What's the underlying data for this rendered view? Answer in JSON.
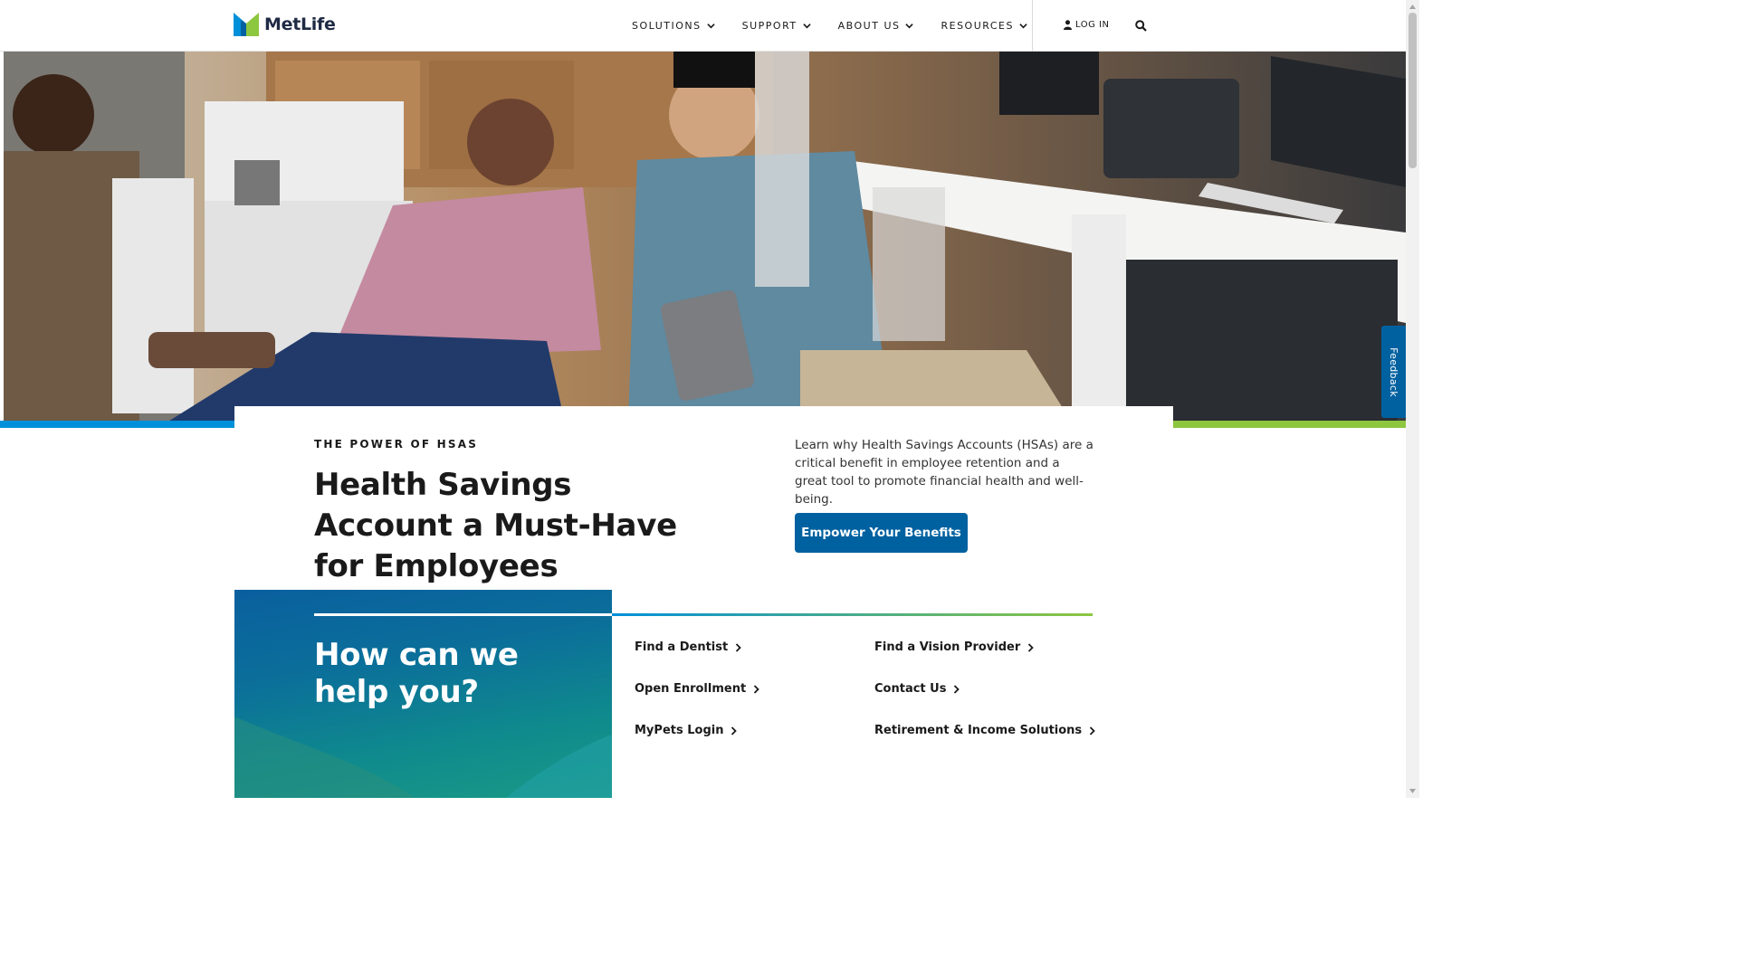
{
  "header": {
    "logo_text": "MetLife",
    "nav": [
      {
        "label": "SOLUTIONS"
      },
      {
        "label": "SUPPORT"
      },
      {
        "label": "ABOUT US"
      },
      {
        "label": "RESOURCES"
      }
    ],
    "login_label": "LOG IN"
  },
  "hero": {
    "feedback_label": "Feedback"
  },
  "feature": {
    "eyebrow": "THE POWER OF HSAS",
    "headline": "Health Savings Account a Must-Have for Employees",
    "intro": "Learn why Health Savings Accounts (HSAs) are a critical benefit in employee retention and a great tool to promote financial health and well-being.",
    "cta_label": "Empower Your Benefits"
  },
  "help": {
    "title": "How can we help you?",
    "links": [
      {
        "label": "Find a Dentist"
      },
      {
        "label": "Find a Vision Provider"
      },
      {
        "label": "Open Enrollment"
      },
      {
        "label": "Contact Us"
      },
      {
        "label": "MyPets Login"
      },
      {
        "label": "Retirement & Income Solutions"
      }
    ]
  },
  "colors": {
    "brand_blue": "#0061a0",
    "accent_blue": "#0090da",
    "accent_green": "#8dc63f",
    "text_dark": "#1a1a1a"
  }
}
